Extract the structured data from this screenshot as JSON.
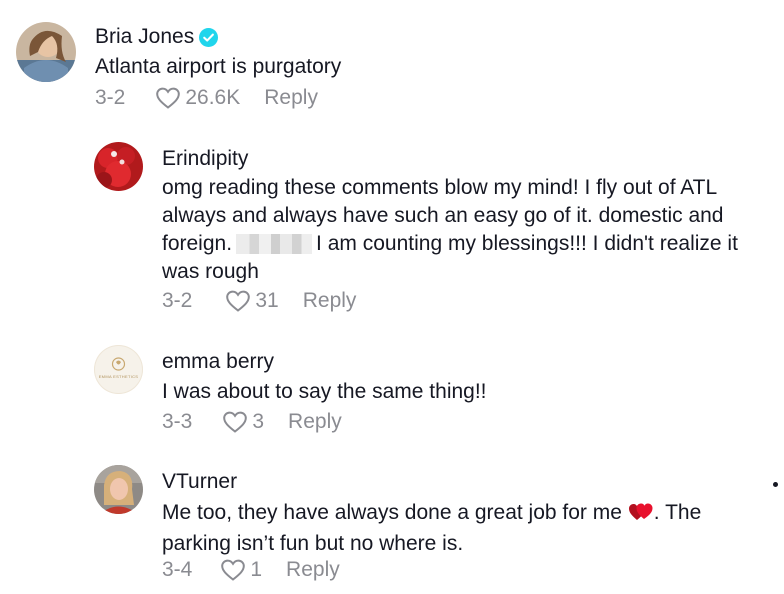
{
  "comments": [
    {
      "author": "Bria Jones",
      "verified": true,
      "text": "Atlanta airport is purgatory",
      "date": "3-2",
      "likes": "26.6K",
      "reply_label": "Reply"
    }
  ],
  "replies": [
    {
      "author": "Erindipity",
      "text_part1": "omg reading these comments blow my mind! I fly out of ATL always and always have such an easy go of it. domestic and foreign.",
      "text_part2": "I am counting my blessings!!! I didn't realize it was rough",
      "date": "3-2",
      "likes": "31",
      "reply_label": "Reply"
    },
    {
      "author": "emma berry",
      "avatar_text": "EMMA ESTHETICS",
      "text": "I was about to say the same thing!!",
      "date": "3-3",
      "likes": "3",
      "reply_label": "Reply"
    },
    {
      "author": "VTurner",
      "text_part1": "Me too, they have always done a great job for me",
      "text_part2": ". The parking isn’t fun but no where is.",
      "date": "3-4",
      "likes": "1",
      "reply_label": "Reply"
    }
  ],
  "icons": {
    "like": "heart-outline-icon",
    "verified": "verified-badge-icon",
    "emoji": "red-hearts-emoji"
  },
  "colors": {
    "text": "#161823",
    "secondary": "#8a8b91",
    "verified": "#20d5ec",
    "emoji_heart": "#e8112d"
  }
}
